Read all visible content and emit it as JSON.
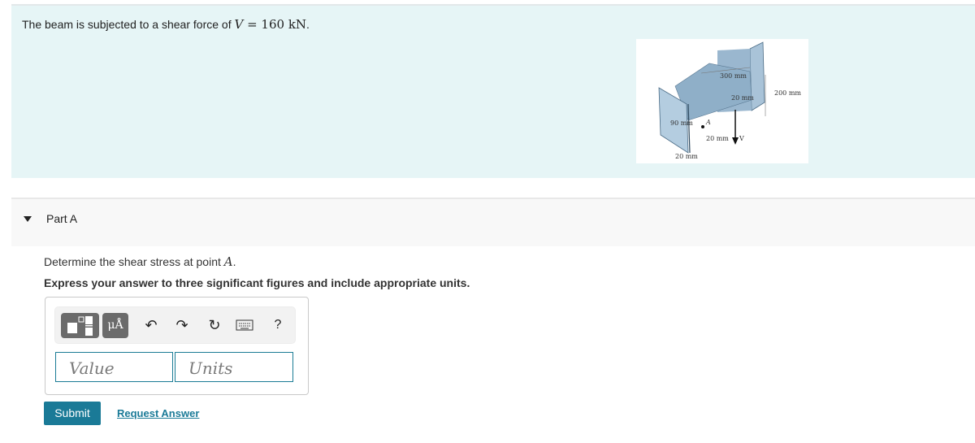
{
  "intro": {
    "text_prefix": "The beam is subjected to a shear force of ",
    "math_var": "V",
    "math_rest": " = 160 kN",
    "text_suffix": "."
  },
  "figure": {
    "labels": {
      "top_width": "300 mm",
      "flange_thickness_top": "20 mm",
      "height": "200 mm",
      "point_a_offset": "90 mm",
      "point_a": "A",
      "web_thickness": "20 mm",
      "bottom_thickness": "20 mm",
      "shear_force": "V"
    }
  },
  "part": {
    "title": "Part A",
    "question_prefix": "Determine the shear stress at point ",
    "question_var": "A",
    "question_suffix": ".",
    "instruction": "Express your answer to three significant figures and include appropriate units."
  },
  "toolbar": {
    "templates_icon": "templates-icon",
    "units_label": "μÅ",
    "undo_icon": "↶",
    "redo_icon": "↷",
    "reset_icon": "↻",
    "keyboard_icon": "keyboard-icon",
    "help_label": "?"
  },
  "inputs": {
    "value_placeholder": "Value",
    "units_placeholder": "Units"
  },
  "actions": {
    "submit_label": "Submit",
    "request_answer_label": "Request Answer"
  },
  "colors": {
    "accent": "#1a7a97",
    "intro_bg": "#e6f5f6",
    "part_bg": "#f8f8f8"
  }
}
